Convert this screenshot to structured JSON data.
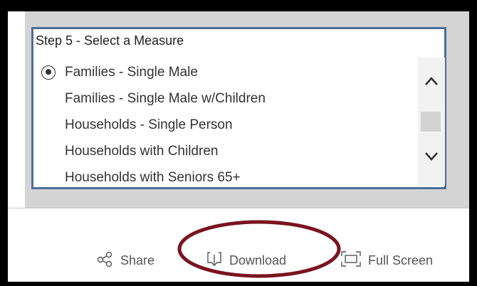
{
  "measure_panel": {
    "title": "Step 5 - Select a Measure",
    "options": [
      {
        "label": "Families - Single Male",
        "selected": true
      },
      {
        "label": "Families - Single Male w/Children",
        "selected": false
      },
      {
        "label": "Households - Single Person",
        "selected": false
      },
      {
        "label": "Households with Children",
        "selected": false
      },
      {
        "label": "Households with Seniors 65+",
        "selected": false
      }
    ],
    "scroll_up_icon": "chevron-up-icon",
    "scroll_down_icon": "chevron-down-icon"
  },
  "toolbar": {
    "share": {
      "label": "Share",
      "icon": "share-icon"
    },
    "download": {
      "label": "Download",
      "icon": "download-icon"
    },
    "fullscreen": {
      "label": "Full Screen",
      "icon": "fullscreen-icon"
    }
  },
  "colors": {
    "panel_border": "#4a6f98",
    "panel_background": "#d4d4d4",
    "highlight_ellipse": "#7a1420"
  }
}
